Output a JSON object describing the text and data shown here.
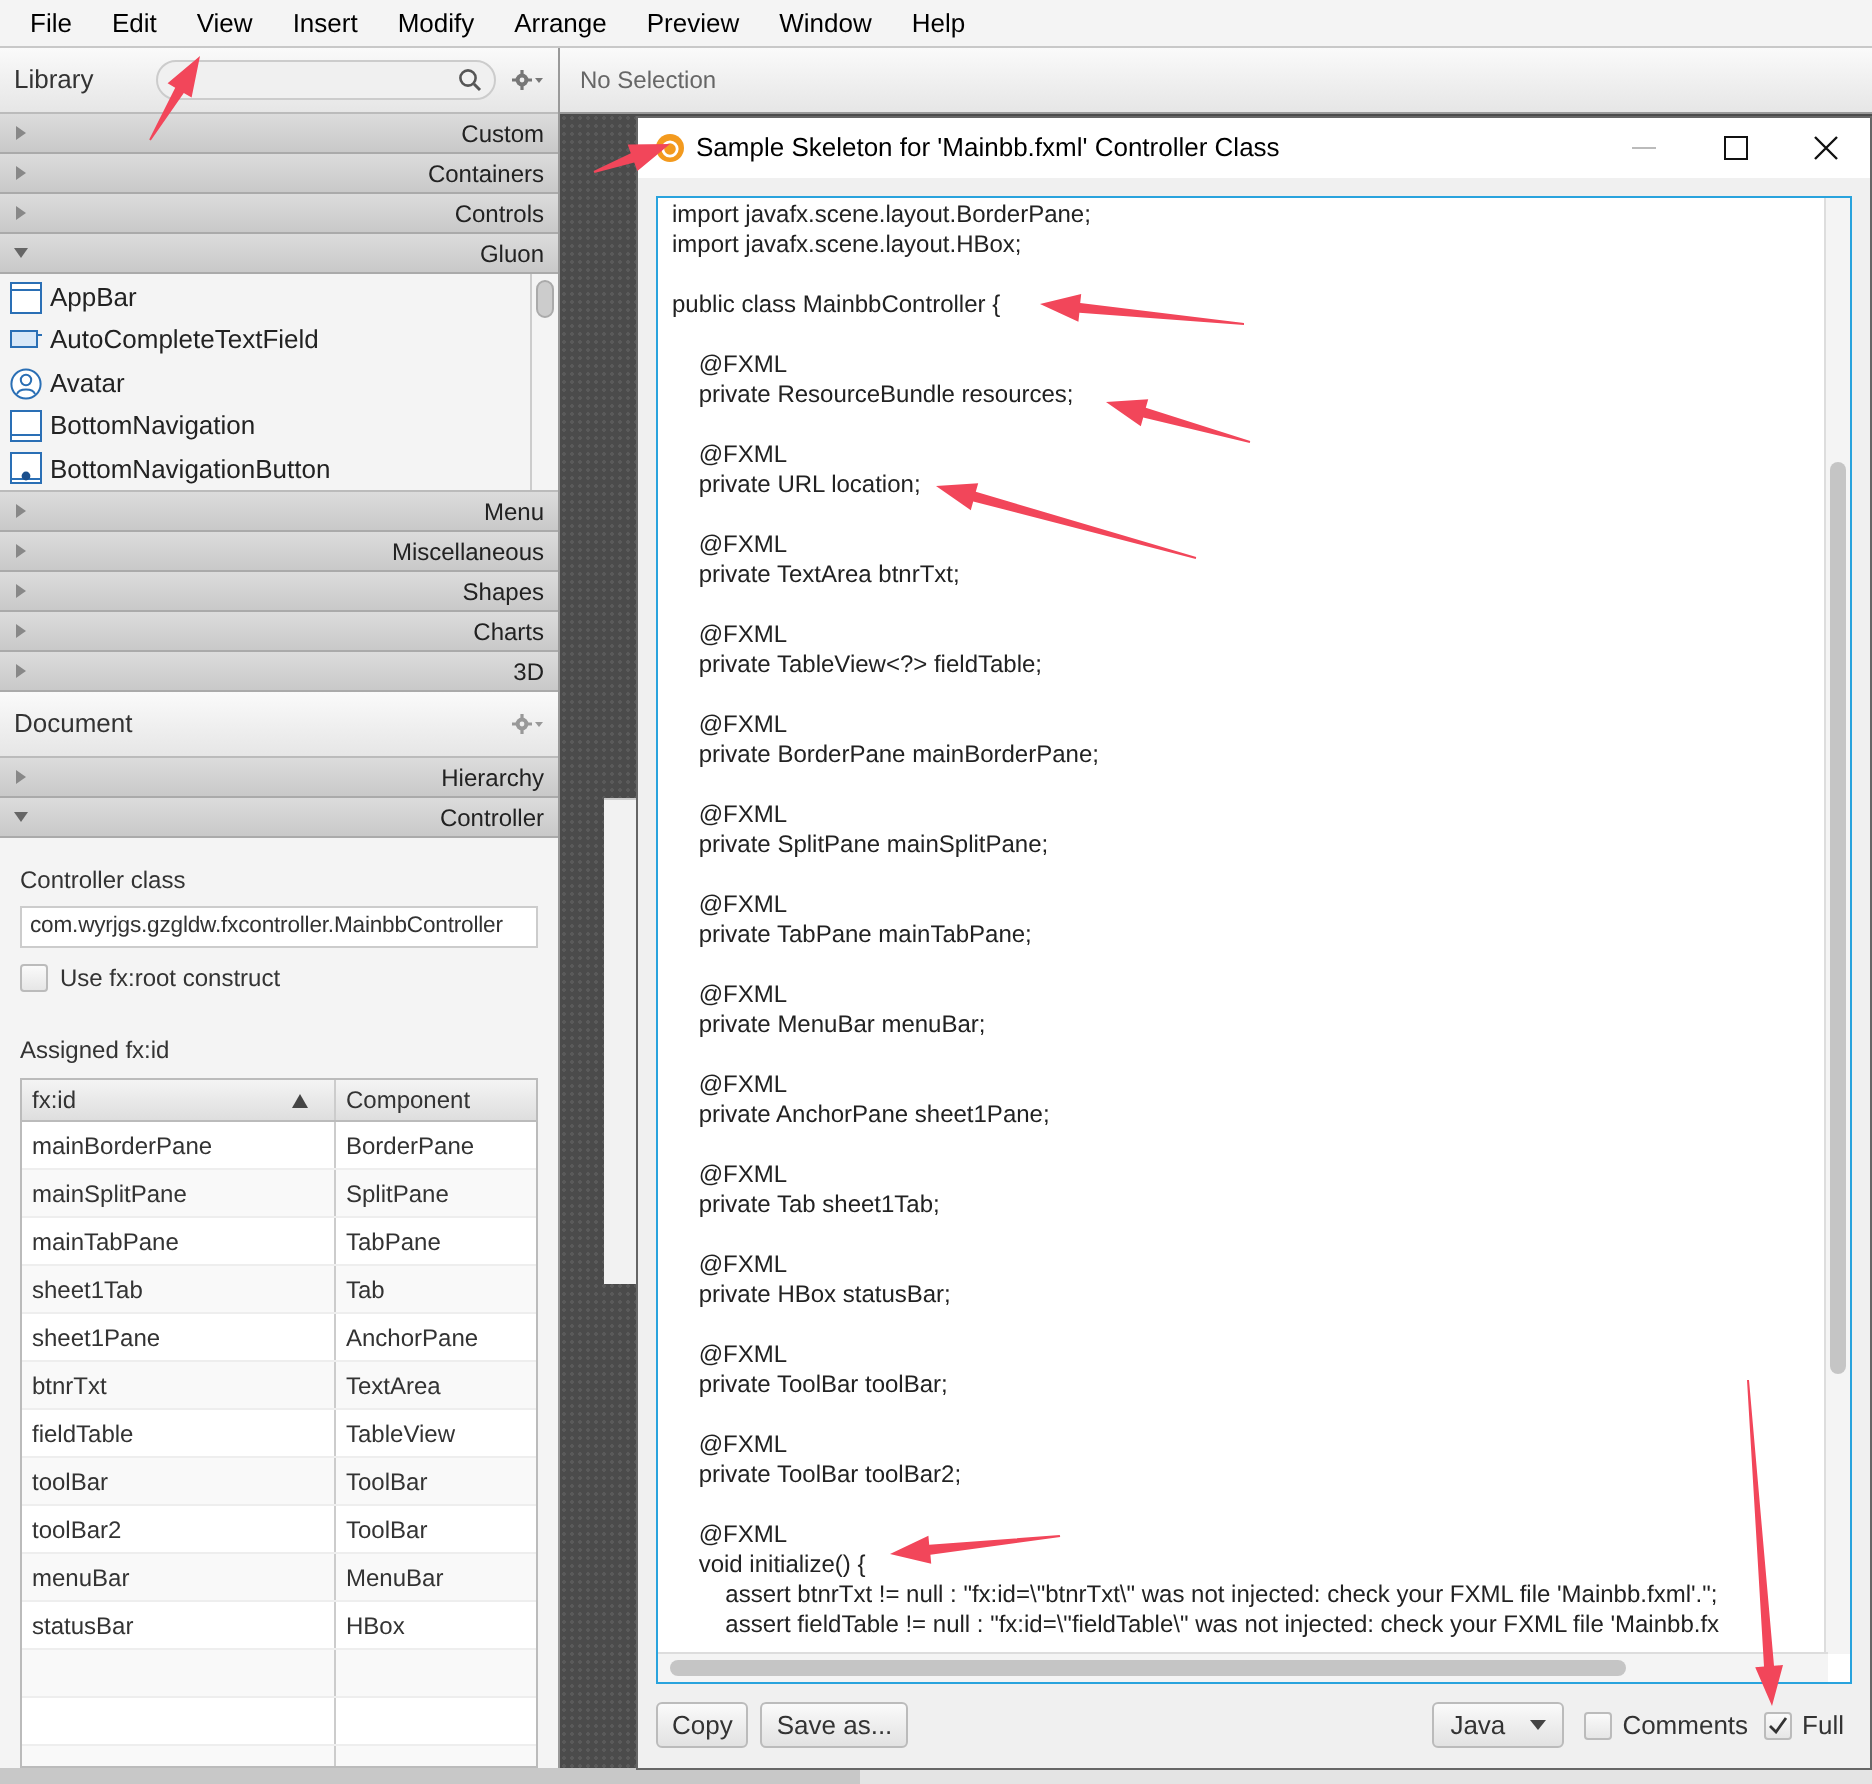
{
  "menu_bar": [
    "File",
    "Edit",
    "View",
    "Insert",
    "Modify",
    "Arrange",
    "Preview",
    "Window",
    "Help"
  ],
  "library": {
    "title": "Library",
    "sections": [
      {
        "label": "Custom",
        "expanded": false
      },
      {
        "label": "Containers",
        "expanded": false
      },
      {
        "label": "Controls",
        "expanded": false
      },
      {
        "label": "Gluon",
        "expanded": true,
        "items": [
          "AppBar",
          "AutoCompleteTextField",
          "Avatar",
          "BottomNavigation",
          "BottomNavigationButton"
        ]
      },
      {
        "label": "Menu",
        "expanded": false
      },
      {
        "label": "Miscellaneous",
        "expanded": false
      },
      {
        "label": "Shapes",
        "expanded": false
      },
      {
        "label": "Charts",
        "expanded": false
      },
      {
        "label": "3D",
        "expanded": false
      }
    ]
  },
  "document": {
    "title": "Document",
    "sections": [
      {
        "label": "Hierarchy",
        "expanded": false
      },
      {
        "label": "Controller",
        "expanded": true
      }
    ],
    "controller_class_label": "Controller class",
    "controller_class": "com.wyrjgs.gzgldw.fxcontroller.MainbbController",
    "fx_root": {
      "label": "Use fx:root construct",
      "checked": false
    },
    "assigned_label": "Assigned fx:id",
    "table": {
      "columns": [
        {
          "label": "fx:id",
          "sorted": true
        },
        {
          "label": "Component"
        }
      ],
      "rows": [
        [
          "mainBorderPane",
          "BorderPane"
        ],
        [
          "mainSplitPane",
          "SplitPane"
        ],
        [
          "mainTabPane",
          "TabPane"
        ],
        [
          "sheet1Tab",
          "Tab"
        ],
        [
          "sheet1Pane",
          "AnchorPane"
        ],
        [
          "btnrTxt",
          "TextArea"
        ],
        [
          "fieldTable",
          "TableView"
        ],
        [
          "toolBar",
          "ToolBar"
        ],
        [
          "toolBar2",
          "ToolBar"
        ],
        [
          "menuBar",
          "MenuBar"
        ],
        [
          "statusBar",
          "HBox"
        ]
      ]
    }
  },
  "content_header": "No Selection",
  "dialog": {
    "title": "Sample Skeleton for 'Mainbb.fxml' Controller Class",
    "code_blocks": [
      [
        "import javafx.scene.layout.BorderPane;",
        "import javafx.scene.layout.HBox;"
      ],
      [
        "public class MainbbController {"
      ],
      [
        "    @FXML",
        "    private ResourceBundle resources;"
      ],
      [
        "    @FXML",
        "    private URL location;"
      ],
      [
        "    @FXML",
        "    private TextArea btnrTxt;"
      ],
      [
        "    @FXML",
        "    private TableView<?> fieldTable;"
      ],
      [
        "    @FXML",
        "    private BorderPane mainBorderPane;"
      ],
      [
        "    @FXML",
        "    private SplitPane mainSplitPane;"
      ],
      [
        "    @FXML",
        "    private TabPane mainTabPane;"
      ],
      [
        "    @FXML",
        "    private MenuBar menuBar;"
      ],
      [
        "    @FXML",
        "    private AnchorPane sheet1Pane;"
      ],
      [
        "    @FXML",
        "    private Tab sheet1Tab;"
      ],
      [
        "    @FXML",
        "    private HBox statusBar;"
      ],
      [
        "    @FXML",
        "    private ToolBar toolBar;"
      ],
      [
        "    @FXML",
        "    private ToolBar toolBar2;"
      ],
      [
        "    @FXML",
        "    void initialize() {",
        "        assert btnrTxt != null : \"fx:id=\\\"btnrTxt\\\" was not injected: check your FXML file 'Mainbb.fxml'.\";",
        "        assert fieldTable != null : \"fx:id=\\\"fieldTable\\\" was not injected: check your FXML file 'Mainbb.fx"
      ]
    ],
    "buttons": [
      "Copy",
      "Save as..."
    ],
    "language": "Java",
    "options": [
      {
        "label": "Comments",
        "checked": false
      },
      {
        "label": "Full",
        "checked": true
      }
    ]
  }
}
